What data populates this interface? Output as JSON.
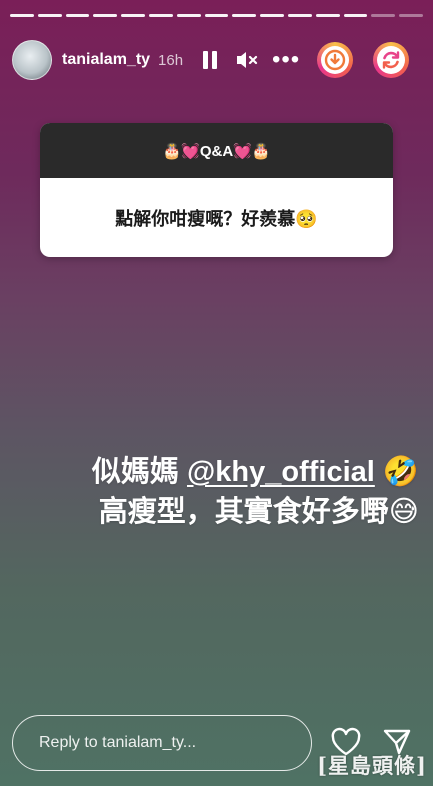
{
  "header": {
    "username": "tanialam_ty",
    "time": "16h",
    "more_label": "•••"
  },
  "icons": {
    "pause": "pause-icon",
    "mute": "mute-icon",
    "more": "more-icon",
    "sticker_download": "download-icon",
    "sticker_refresh": "refresh-icon",
    "heart": "heart-icon",
    "send": "send-icon"
  },
  "qa": {
    "title": "🎂💓Q&A💓🎂",
    "question": "點解你咁瘦嘅？好羨慕🥺"
  },
  "caption": {
    "line1_prefix": "似媽媽 ",
    "mention": "@khy_official",
    "line1_suffix": " 🤣",
    "line2": "高瘦型，其實食好多嘢😅"
  },
  "reply": {
    "placeholder": "Reply to tanialam_ty..."
  },
  "watermark": "[星島頭條]",
  "colors": {
    "bg_top": "#7a1f58",
    "bg_bottom": "#4f7264",
    "qa_header": "#2a2a2a"
  }
}
